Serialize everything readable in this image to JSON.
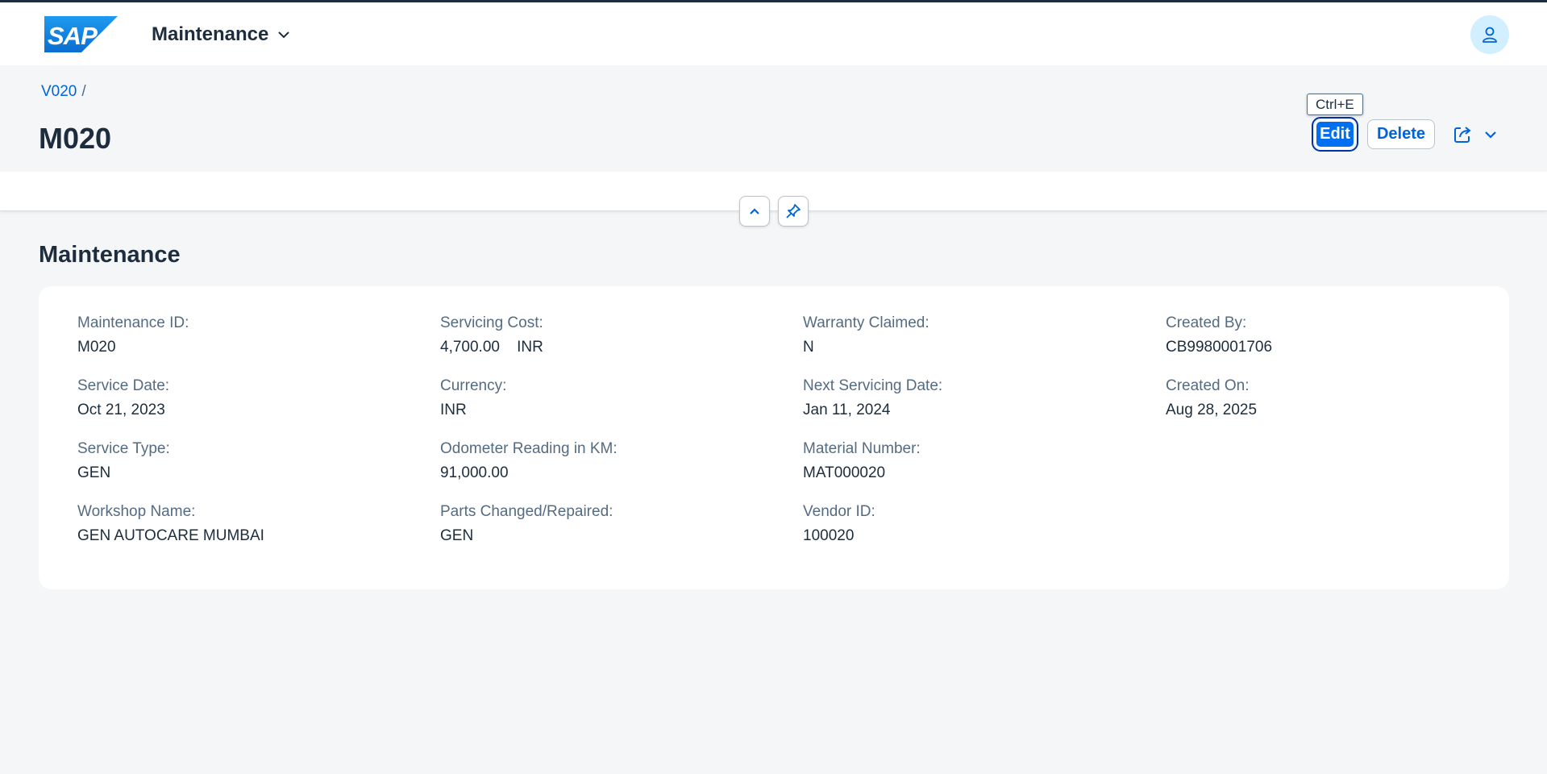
{
  "shell": {
    "app_title": "Maintenance",
    "logo_text": "SAP"
  },
  "header": {
    "breadcrumb": {
      "link": "V020",
      "separator": "/"
    },
    "title": "M020",
    "actions": {
      "edit_label": "Edit",
      "delete_label": "Delete",
      "edit_tooltip": "Ctrl+E"
    }
  },
  "section": {
    "title": "Maintenance",
    "columns": [
      [
        {
          "label": "Maintenance ID:",
          "value": "M020"
        },
        {
          "label": "Service Date:",
          "value": "Oct 21, 2023"
        },
        {
          "label": "Service Type:",
          "value": "GEN"
        },
        {
          "label": "Workshop Name:",
          "value": "GEN AUTOCARE MUMBAI"
        }
      ],
      [
        {
          "label": "Servicing Cost:",
          "value": "4,700.00    INR"
        },
        {
          "label": "Currency:",
          "value": "INR"
        },
        {
          "label": "Odometer Reading in KM:",
          "value": "91,000.00"
        },
        {
          "label": "Parts Changed/Repaired:",
          "value": "GEN"
        }
      ],
      [
        {
          "label": "Warranty Claimed:",
          "value": "N"
        },
        {
          "label": "Next Servicing Date:",
          "value": "Jan 11, 2024"
        },
        {
          "label": "Material Number:",
          "value": "MAT000020"
        },
        {
          "label": "Vendor ID:",
          "value": "100020"
        }
      ],
      [
        {
          "label": "Created By:",
          "value": "CB9980001706"
        },
        {
          "label": "Created On:",
          "value": "Aug 28, 2025"
        }
      ]
    ]
  },
  "icons": {
    "dropdown": "chevron-down-icon",
    "user": "person-icon",
    "share": "share-icon",
    "collapse": "chevron-up-icon",
    "pin": "pin-icon"
  },
  "colors": {
    "accent": "#0070f2",
    "link": "#0064d9",
    "text": "#1d2d3e",
    "label": "#556b82",
    "background": "#f5f6f7",
    "avatar_bg": "#d1efff"
  }
}
